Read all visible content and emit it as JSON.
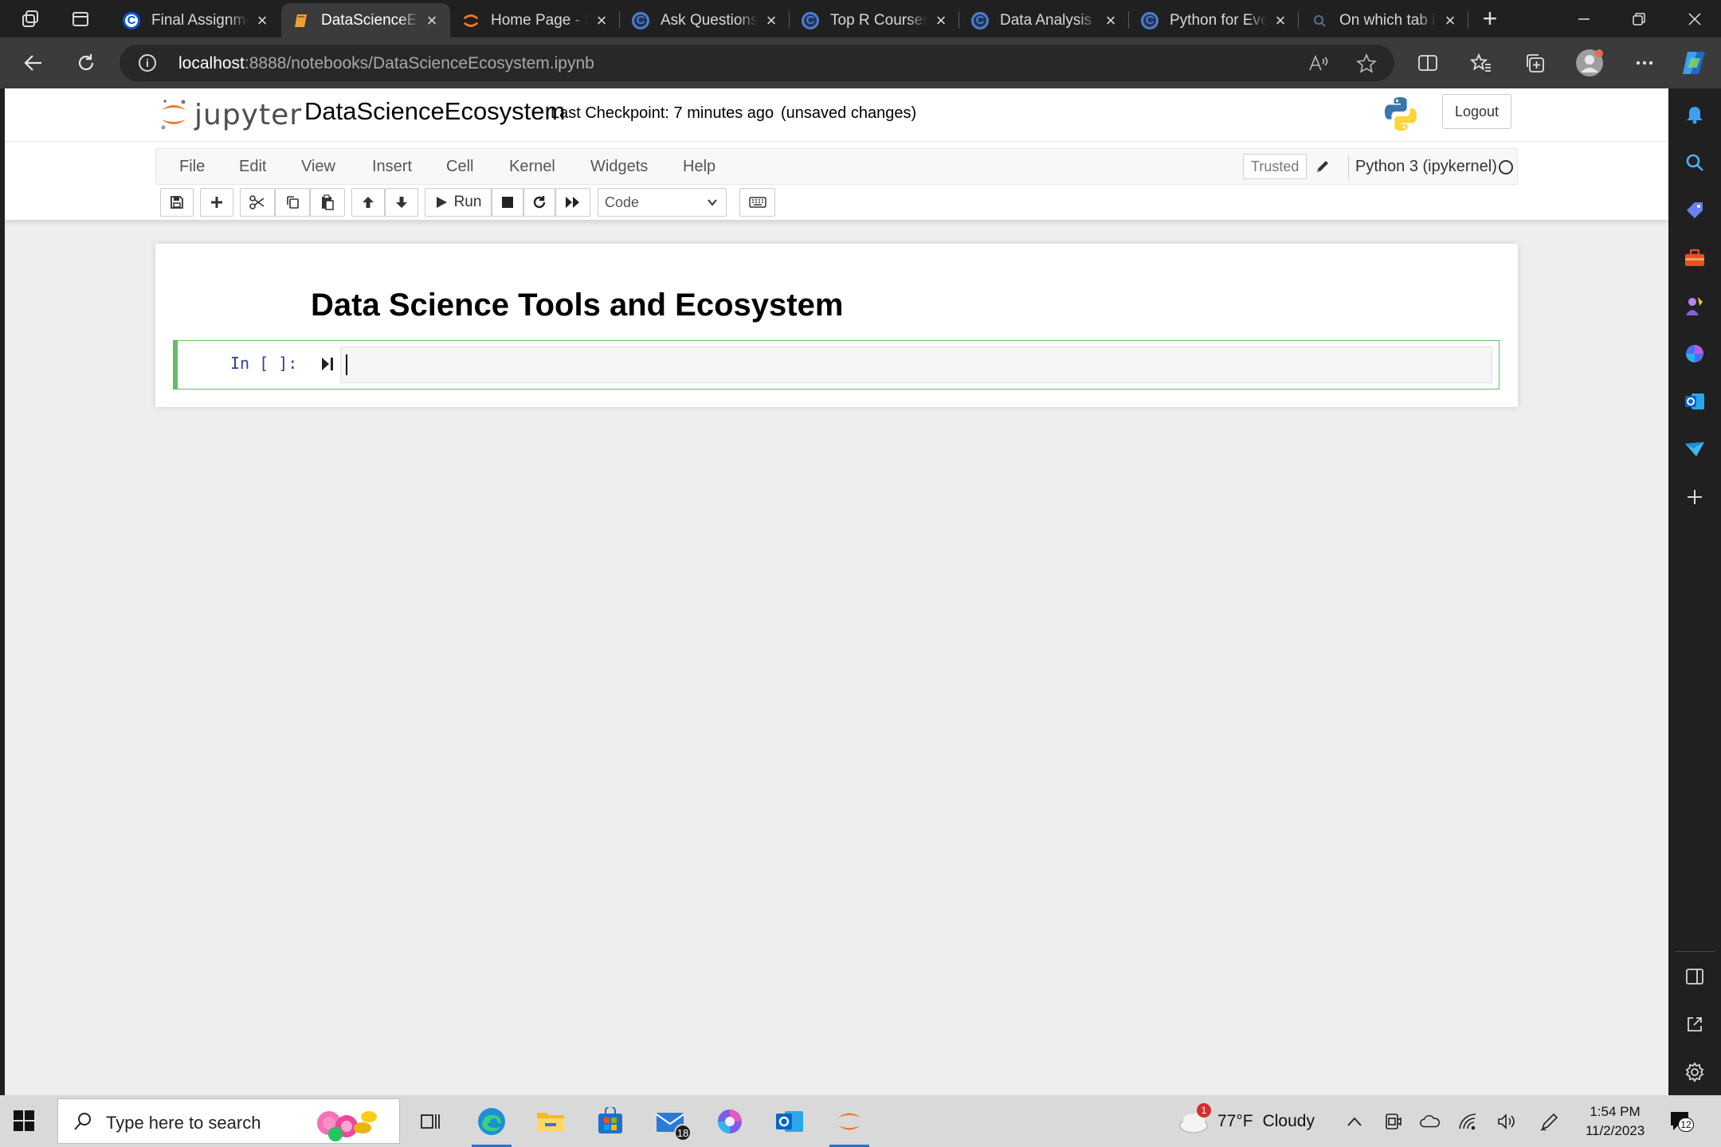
{
  "browser": {
    "tabs": [
      {
        "label": "Final Assignment",
        "icon": "coursera-icon",
        "active": false
      },
      {
        "label": "DataScienceEcosystem",
        "icon": "notebook-icon",
        "active": true
      },
      {
        "label": "Home Page - Se",
        "icon": "jupyter-icon",
        "active": false
      },
      {
        "label": "Ask Questions",
        "icon": "coursera-icon",
        "active": false
      },
      {
        "label": "Top R Courses",
        "icon": "coursera-icon",
        "active": false
      },
      {
        "label": "Data Analysis w",
        "icon": "coursera-icon",
        "active": false
      },
      {
        "label": "Python for Every",
        "icon": "coursera-icon",
        "active": false
      },
      {
        "label": "On which tab i",
        "icon": "search-icon",
        "active": false
      }
    ],
    "url_host": "localhost",
    "url_path": ":8888/notebooks/DataScienceEcosystem.ipynb"
  },
  "jupyter": {
    "logo_text": "jupyter",
    "notebook_name": "DataScienceEcosystem",
    "checkpoint": "Last Checkpoint: 7 minutes ago",
    "unsaved": "(unsaved changes)",
    "logout_label": "Logout",
    "menu": [
      "File",
      "Edit",
      "View",
      "Insert",
      "Cell",
      "Kernel",
      "Widgets",
      "Help"
    ],
    "trusted_label": "Trusted",
    "kernel_name": "Python 3 (ipykernel)",
    "toolbar": {
      "run_label": "Run",
      "cell_type": "Code"
    },
    "cells": {
      "heading": "Data Science Tools and Ecosystem",
      "prompt": "In [ ]:",
      "code": ""
    }
  },
  "taskbar": {
    "search_placeholder": "Type here to search",
    "mail_badge": "18",
    "weather_temp": "77°F",
    "weather_cond": "Cloudy",
    "weather_alert": "1",
    "time": "1:54 PM",
    "date": "11/2/2023",
    "notification_count": "12"
  },
  "colors": {
    "jupyter_orange": "#F37626",
    "cell_selected_border": "#66BB6A",
    "prompt_blue": "#303F9F",
    "edge_dark": "#202020"
  }
}
